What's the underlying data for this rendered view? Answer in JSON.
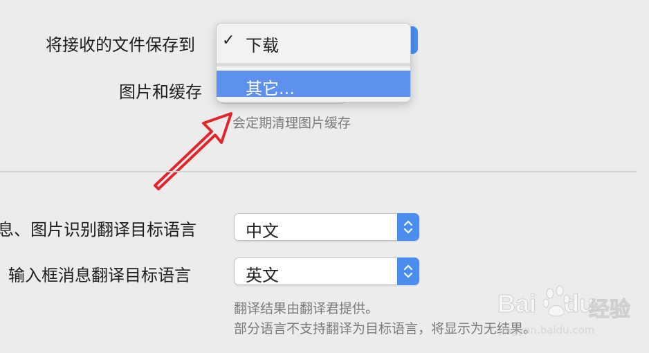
{
  "settings": {
    "save_received_label": "将接收的文件保存到",
    "images_cache_label": "图片和缓存",
    "cache_hint": "会定期清理图片缓存",
    "msg_translate_label": "息、图片识别翻译目标语言",
    "msg_translate_value": "中文",
    "input_translate_label": "输入框消息翻译目标语言",
    "input_translate_value": "英文",
    "provider_note": "翻译结果由翻译君提供。",
    "unsupported_note": "部分语言不支持翻译为目标语言，将显示为无结果。"
  },
  "dropdown_menu": {
    "items": [
      {
        "check": "✓",
        "label": "下载"
      },
      {
        "check": "",
        "label": "其它..."
      }
    ]
  },
  "watermark": {
    "brand": "Bai",
    "brand2": "du",
    "cn": "经验",
    "url": "jingyan.baidu.com"
  },
  "colors": {
    "accent": "#4a8ff0",
    "menu_highlight": "#5e91ee",
    "annotation_arrow": "#e0262b"
  },
  "icons": {
    "stepper": "chevron-up-down-icon",
    "check": "checkmark-icon",
    "annotation": "red-arrow-icon"
  }
}
